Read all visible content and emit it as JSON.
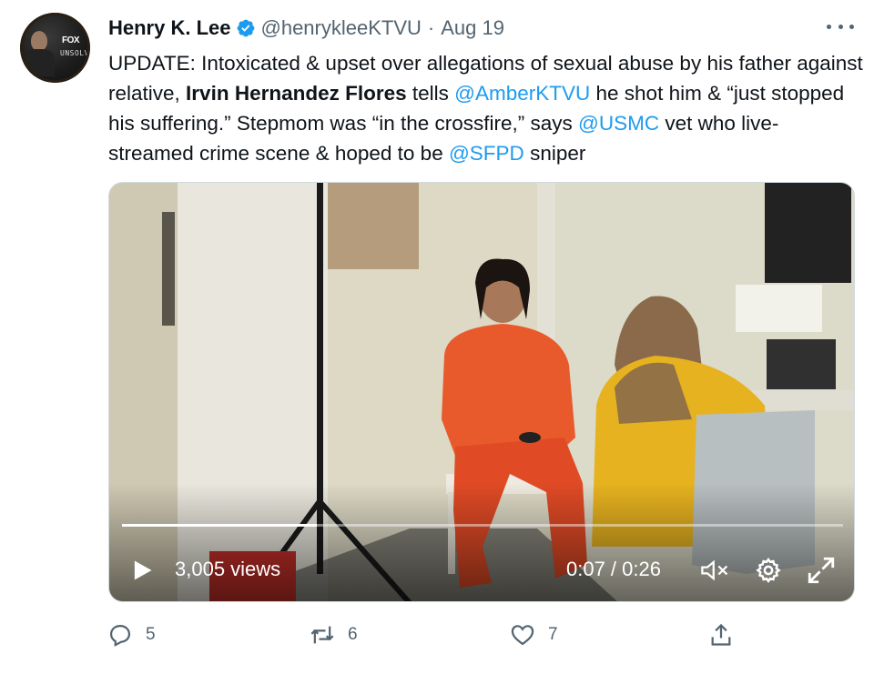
{
  "author": {
    "name": "Henry K. Lee",
    "handle": "@henrykleeKTVU",
    "separator": "·",
    "date": "Aug 19",
    "avatar_text": "FOX",
    "avatar_subtext": "UNSOLVED"
  },
  "tweet": {
    "p1": "UPDATE: Intoxicated & upset over allegations of sexual abuse by his father against relative, ",
    "bold": "Irvin Hernandez Flores",
    "p2": " tells ",
    "m1": "@AmberKTVU",
    "p3": " he shot him & “just stopped his suffering.” Stepmom was “in the crossfire,” says ",
    "m2": "@USMC",
    "p4": " vet who live-streamed crime scene & hoped to be ",
    "m3": "@SFPD",
    "p5": " sniper"
  },
  "video": {
    "views": "3,005 views",
    "time": "0:07 / 0:26",
    "progress": 0.27
  },
  "actions": {
    "replies": "5",
    "retweets": "6",
    "likes": "7"
  },
  "colors": {
    "link": "#1d9bf0",
    "secondary_text": "#536471",
    "verified": "#1d9bf0"
  },
  "icons": [
    "verified-badge-icon",
    "more-icon",
    "play-icon",
    "mute-icon",
    "settings-icon",
    "fullscreen-icon",
    "reply-icon",
    "retweet-icon",
    "like-icon",
    "share-icon"
  ]
}
